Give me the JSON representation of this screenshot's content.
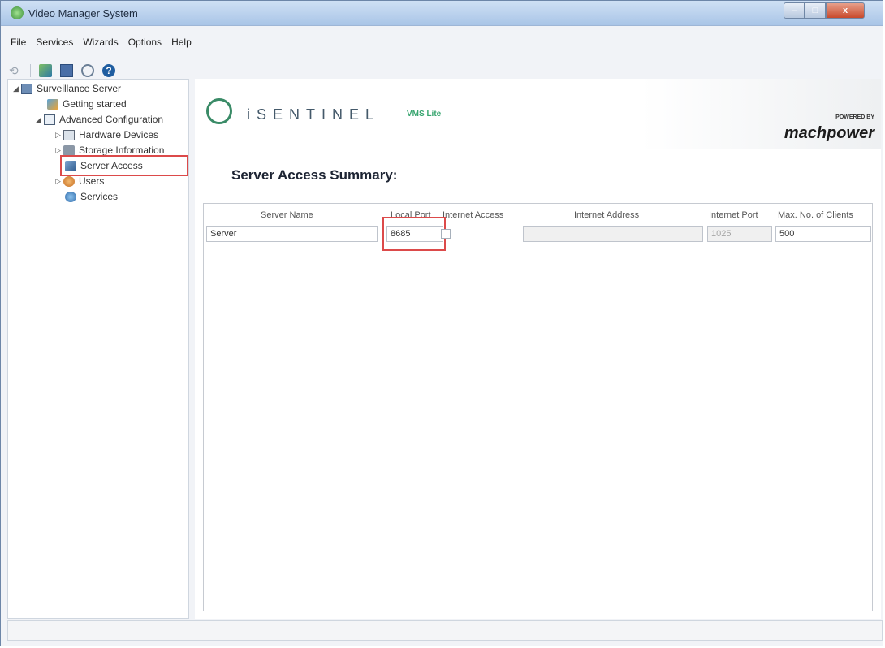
{
  "window": {
    "title": "Video Manager System"
  },
  "menu": [
    "File",
    "Services",
    "Wizards",
    "Options",
    "Help"
  ],
  "tree": {
    "root": "Surveillance Server",
    "items": [
      "Getting started",
      "Advanced Configuration",
      "Hardware Devices",
      "Storage Information",
      "Server Access",
      "Users",
      "Services"
    ]
  },
  "banner": {
    "brand": "iSENTINEL",
    "product": "VMS Lite",
    "powered_by": "POWERED BY",
    "partner": "machpower"
  },
  "page": {
    "title": "Server Access Summary:"
  },
  "table": {
    "headers": [
      "Server Name",
      "Local Port",
      "Internet Access",
      "Internet Address",
      "Internet Port",
      "Max. No. of Clients"
    ],
    "row": {
      "server_name": "Server",
      "local_port": "8685",
      "internet_access": false,
      "internet_address": "",
      "internet_port": "1025",
      "max_clients": "500"
    }
  }
}
